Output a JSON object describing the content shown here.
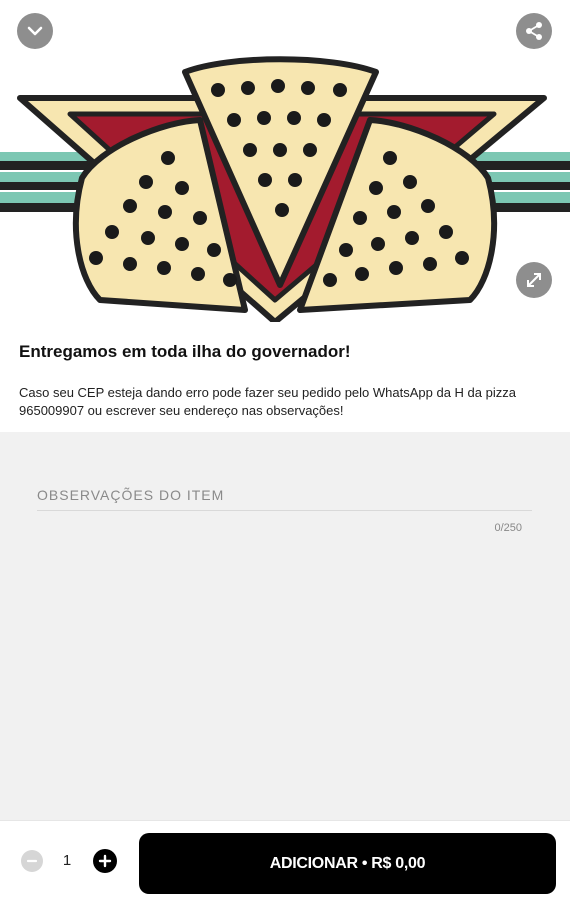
{
  "hero": {
    "collapse_icon": "chevron-down-icon",
    "share_icon": "share-icon",
    "expand_icon": "expand-icon"
  },
  "item": {
    "title": "Entregamos em toda ilha do governador!",
    "description": "Caso seu CEP esteja dando erro pode fazer seu pedido pelo WhatsApp da H da pizza 965009907 ou escrever seu endereço nas observações!"
  },
  "observations": {
    "placeholder": "OBSERVAÇÕES DO ITEM",
    "value": "",
    "counter": "0/250"
  },
  "footer": {
    "quantity": "1",
    "add_label": "ADICIONAR • R$ 0,00"
  },
  "colors": {
    "accent": "#000000",
    "pizza_cream": "#f7e6b0",
    "pizza_red": "#a31b2e",
    "stripe_teal": "#7cc7b3"
  }
}
